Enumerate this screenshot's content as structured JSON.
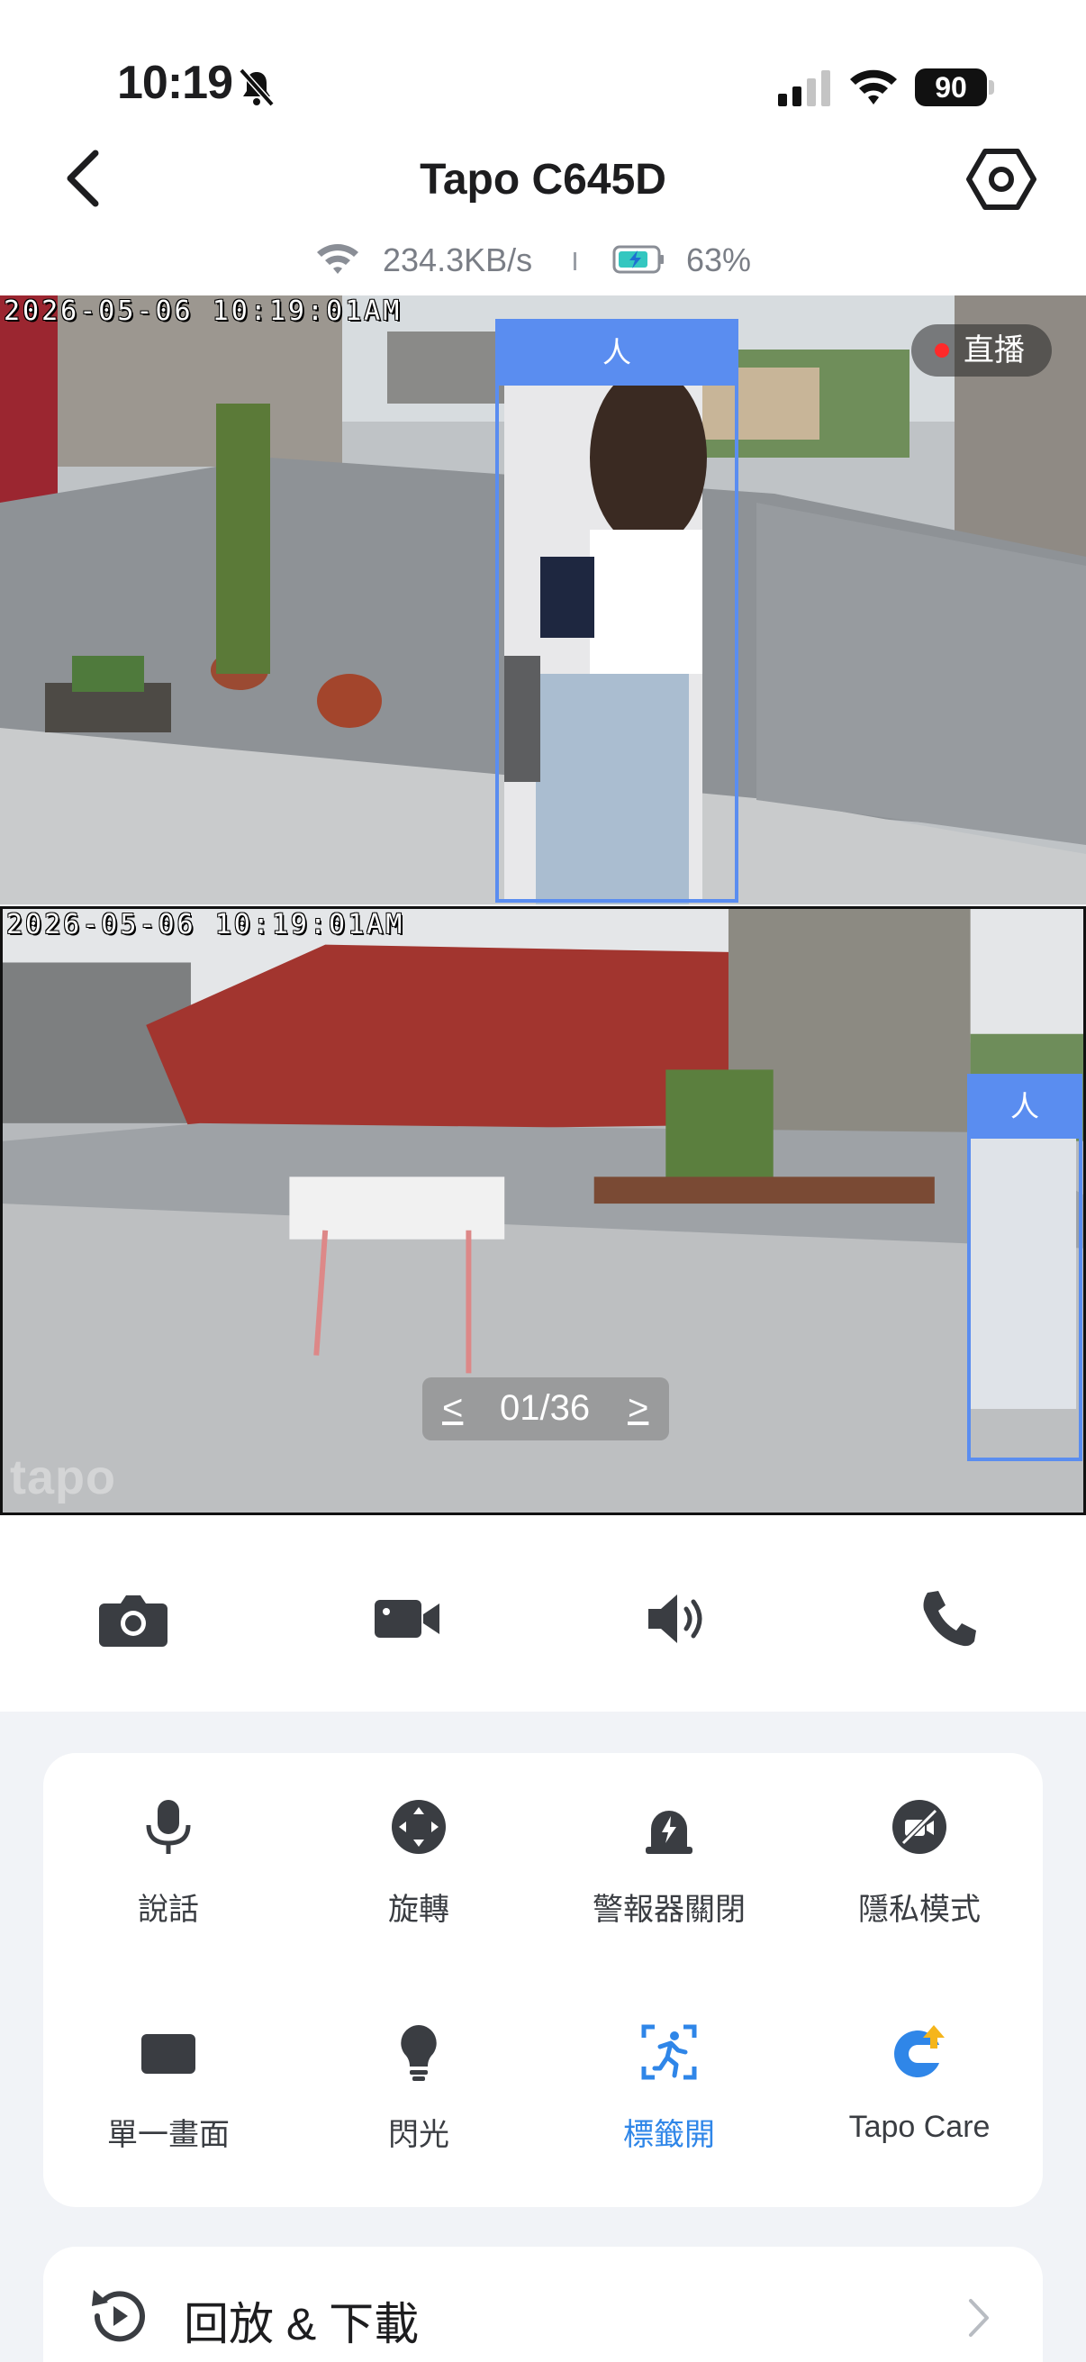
{
  "status_bar": {
    "time": "10:19",
    "battery": "90"
  },
  "header": {
    "title": "Tapo C645D",
    "speed": "234.3KB/s",
    "battery_percent": "63%"
  },
  "feeds": {
    "top": {
      "timestamp": "2026-05-06 10:19:01AM",
      "live_label": "直播",
      "detection_label": "人"
    },
    "bottom": {
      "timestamp": "2026-05-06 10:19:01AM",
      "detection_label": "人",
      "watermark": "tapo"
    }
  },
  "pager": {
    "prev": "<",
    "current": "01/36",
    "next": ">"
  },
  "controls": {
    "icons": [
      "camera-icon",
      "video-record-icon",
      "speaker-icon",
      "phone-icon"
    ]
  },
  "functions": [
    {
      "label": "說話",
      "icon": "microphone-icon"
    },
    {
      "label": "旋轉",
      "icon": "rotate-icon"
    },
    {
      "label": "警報器關閉",
      "icon": "siren-icon"
    },
    {
      "label": "隱私模式",
      "icon": "privacy-icon"
    },
    {
      "label": "單一畫面",
      "icon": "single-view-icon"
    },
    {
      "label": "閃光",
      "icon": "bulb-icon"
    },
    {
      "label": "標籤開",
      "icon": "tag-person-icon",
      "active": true
    },
    {
      "label": "Tapo Care",
      "icon": "tapo-care-icon"
    }
  ],
  "playback": {
    "label": "回放 & 下載"
  },
  "colors": {
    "accent": "#2f86e8",
    "detection": "#5a8df0",
    "live_dot": "#ff2a2a",
    "icon": "#3a3d42"
  }
}
